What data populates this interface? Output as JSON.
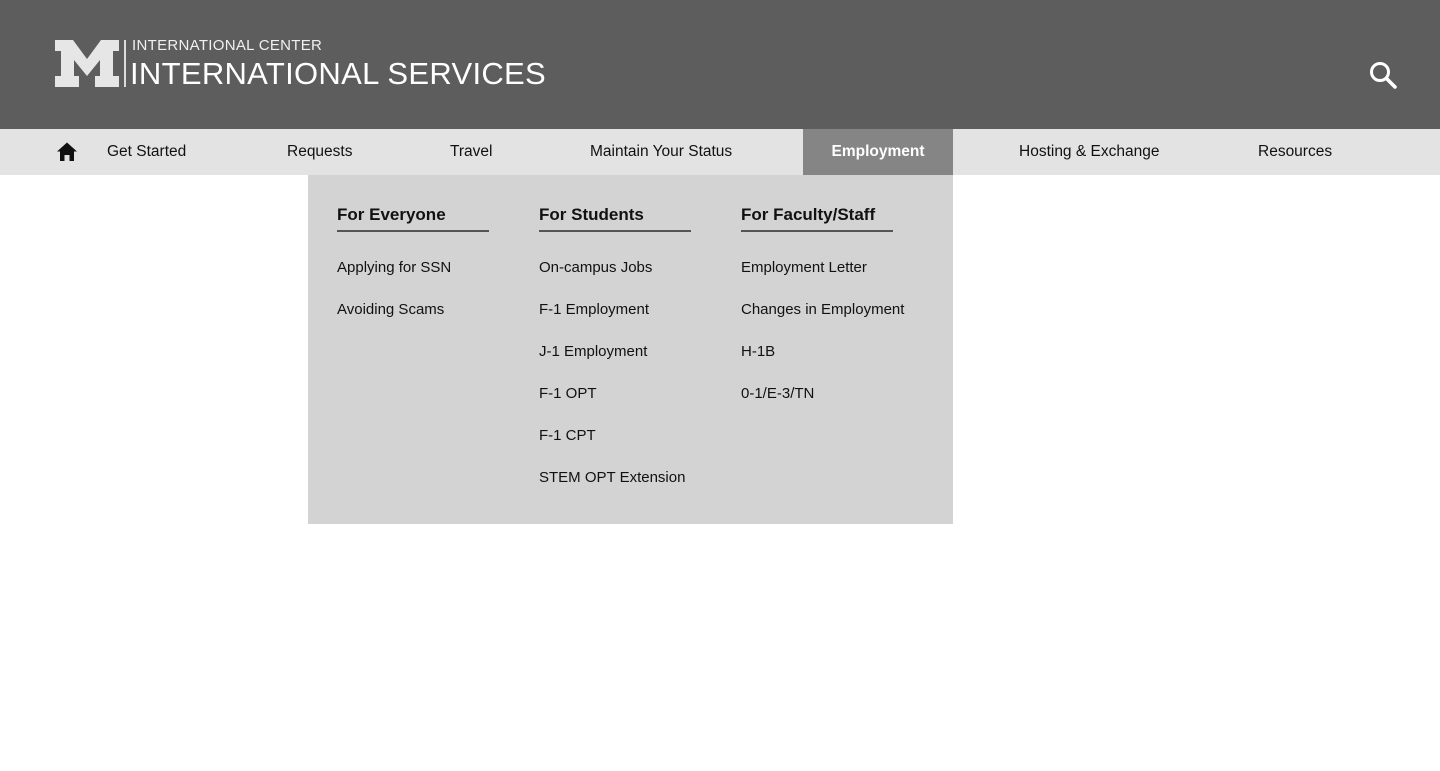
{
  "header": {
    "org_small": "INTERNATIONAL CENTER",
    "org_large": "INTERNATIONAL SERVICES",
    "logo_icon": "block-m-logo",
    "search_icon": "search-icon"
  },
  "nav": {
    "home_icon": "home-icon",
    "items": [
      {
        "label": "Get Started"
      },
      {
        "label": "Requests"
      },
      {
        "label": "Travel"
      },
      {
        "label": "Maintain Your Status"
      },
      {
        "label": "Employment",
        "active": true
      },
      {
        "label": "Hosting & Exchange"
      },
      {
        "label": "Resources"
      }
    ]
  },
  "dropdown": {
    "columns": [
      {
        "heading": "For Everyone",
        "links": [
          "Applying for SSN",
          "Avoiding Scams"
        ]
      },
      {
        "heading": "For Students",
        "links": [
          "On-campus Jobs",
          "F-1 Employment",
          "J-1 Employment",
          "F-1 OPT",
          "F-1 CPT",
          "STEM OPT Extension"
        ]
      },
      {
        "heading": "For Faculty/Staff",
        "links": [
          "Employment Letter",
          "Changes in Employment",
          "H-1B",
          "0-1/E-3/TN"
        ]
      }
    ]
  },
  "colors": {
    "header_bg": "#5d5d5d",
    "nav_bg": "#e3e3e3",
    "nav_active_bg": "#858585",
    "dropdown_bg": "#d3d3d3"
  }
}
